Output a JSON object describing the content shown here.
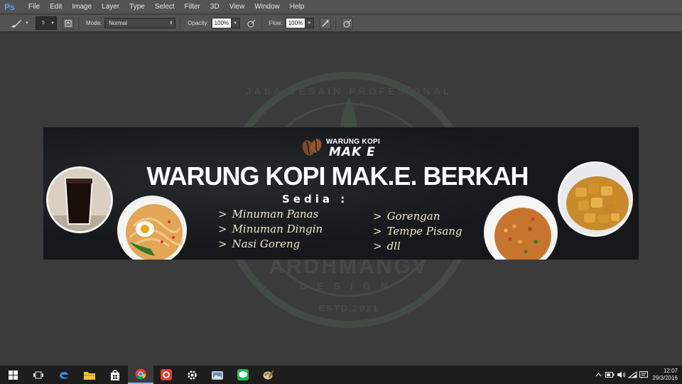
{
  "app": {
    "logo": "Ps"
  },
  "menu": [
    "File",
    "Edit",
    "Image",
    "Layer",
    "Type",
    "Select",
    "Filter",
    "3D",
    "View",
    "Window",
    "Help"
  ],
  "options": {
    "brush_size": "5",
    "mode_label": "Mode:",
    "mode_value": "Normal",
    "opacity_label": "Opacity:",
    "opacity_value": "100%",
    "flow_label": "Flow:",
    "flow_value": "100%"
  },
  "watermark": {
    "ring_text": "JASA DESAIN PROFESIONAL",
    "name": "ARDHMANGV",
    "sub": "DESIGN",
    "estd": "ESTD.2021"
  },
  "banner": {
    "logo_top": "WARUNG KOPI",
    "logo_bottom": "MAK E",
    "headline": "WARUNG KOPI MAK.E. BERKAH",
    "sedia": "Sedia :",
    "menu_left": [
      "Minuman Panas",
      "Minuman Dingin",
      "Nasi Goreng"
    ],
    "menu_right": [
      "Gorengan",
      "Tempe Pisang",
      "dll"
    ],
    "colors": {
      "background": "#17191b",
      "headline": "#ffffff",
      "list_text": "#f2e6c6"
    }
  },
  "taskbar": {
    "icons": [
      "windows-start-icon",
      "task-view-icon",
      "edge-browser-icon",
      "file-explorer-icon",
      "store-icon",
      "chrome-icon",
      "app-red-icon",
      "settings-gear-icon",
      "photos-app-icon",
      "line-messenger-icon",
      "paint-app-icon"
    ],
    "time": "12:07",
    "date": "29/3/2016"
  }
}
